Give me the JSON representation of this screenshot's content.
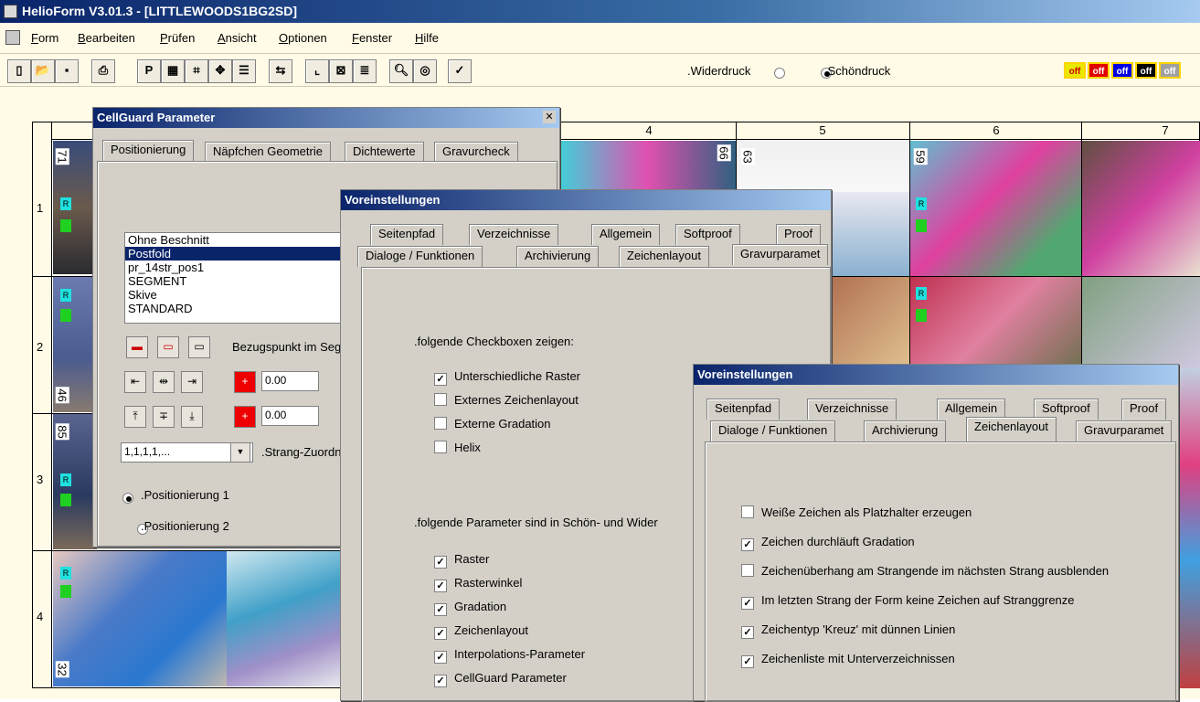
{
  "app": {
    "title": "HelioForm  V3.01.3 - [LITTLEWOODS1BG2SD]"
  },
  "menu": [
    "Form",
    "Bearbeiten",
    "Prüfen",
    "Ansicht",
    "Optionen",
    "Fenster",
    "Hilfe"
  ],
  "toolbar": {
    "p_label": "P",
    "radio_wider": ".Widerdruck",
    "radio_schoen": ".Schöndruck",
    "off_label": "off"
  },
  "grid": {
    "columns": [
      "4",
      "5",
      "6",
      "7"
    ],
    "rows": [
      "1",
      "2",
      "3",
      "4"
    ],
    "thumb_numbers": [
      "71",
      "46",
      "85",
      "32",
      "66",
      "63",
      "59"
    ],
    "marker_r": "R"
  },
  "cellguard": {
    "title": "CellGuard Parameter",
    "tabs": [
      "Positionierung",
      "Näpfchen Geometrie",
      "Dichtewerte",
      "Gravurcheck"
    ],
    "list": [
      "Ohne Beschnitt",
      "Postfold",
      "pr_14str_pos1",
      "SEGMENT",
      "Skive",
      "STANDARD"
    ],
    "bezugspunkt": "Bezugspunkt im Seg",
    "value1": "0.00",
    "value2": "0.00",
    "combo_value": "1,1,1,1,...",
    "strang_label": ".Strang-Zuordn",
    "pos1": ".Positionierung 1",
    "pos2": ".Positionierung 2"
  },
  "voreinst1": {
    "title": "Voreinstellungen",
    "tabs_row1": [
      "Seitenpfad",
      "Verzeichnisse",
      "Allgemein",
      "Softproof",
      "Proof"
    ],
    "tabs_row2": [
      "Dialoge / Funktionen",
      "Archivierung",
      "Zeichenlayout",
      "Gravurparamet"
    ],
    "section1": ".folgende Checkboxen zeigen:",
    "checks1": [
      "Unterschiedliche Raster",
      "Externes Zeichenlayout",
      "Externe Gradation",
      "Helix"
    ],
    "section2": ".folgende Parameter sind in Schön- und Wider",
    "checks2": [
      "Raster",
      "Rasterwinkel",
      "Gradation",
      "Zeichenlayout",
      "Interpolations-Parameter",
      "CellGuard Parameter"
    ]
  },
  "voreinst2": {
    "title": "Voreinstellungen",
    "tabs_row1": [
      "Seitenpfad",
      "Verzeichnisse",
      "Allgemein",
      "Softproof",
      "Proof"
    ],
    "tabs_row2": [
      "Dialoge / Funktionen",
      "Archivierung",
      "Zeichenlayout",
      "Gravurparamet"
    ],
    "checks": [
      "Weiße Zeichen als Platzhalter erzeugen",
      "Zeichen durchläuft Gradation",
      "Zeichenüberhang am Strangende im nächsten Strang ausblenden",
      "Im letzten Strang der Form keine Zeichen auf Stranggrenze",
      "Zeichentyp 'Kreuz' mit dünnen Linien",
      "Zeichenliste mit Unterverzeichnissen"
    ]
  }
}
